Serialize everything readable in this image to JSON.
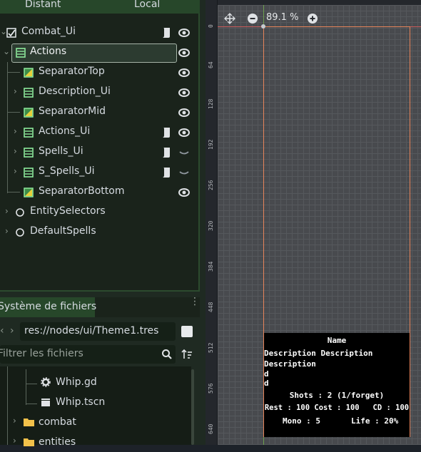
{
  "tabs": {
    "distant": "Distant",
    "local": "Local"
  },
  "tree": [
    {
      "label": "Combat_Ui",
      "icon": "control-icon",
      "script": true,
      "visible": "eye"
    },
    {
      "label": "Actions",
      "icon": "vbox-icon",
      "script": false,
      "visible": "eye",
      "selected": true
    },
    {
      "label": "SeparatorTop",
      "icon": "texture-rect-icon",
      "script": false,
      "visible": "eye"
    },
    {
      "label": "Description_Ui",
      "icon": "vbox-icon",
      "script": false,
      "visible": "eye"
    },
    {
      "label": "SeparatorMid",
      "icon": "texture-rect-icon",
      "script": false,
      "visible": "eye"
    },
    {
      "label": "Actions_Ui",
      "icon": "vbox-icon",
      "script": true,
      "visible": "eye"
    },
    {
      "label": "Spells_Ui",
      "icon": "vbox-icon",
      "script": true,
      "visible": "hidden"
    },
    {
      "label": "S_Spells_Ui",
      "icon": "vbox-icon",
      "script": true,
      "visible": "hidden"
    },
    {
      "label": "SeparatorBottom",
      "icon": "texture-rect-icon",
      "script": false,
      "visible": "eye"
    },
    {
      "label": "EntitySelectors",
      "icon": "node-icon",
      "script": false,
      "visible": "none"
    },
    {
      "label": "DefaultSpells",
      "icon": "node-icon",
      "script": false,
      "visible": "none"
    }
  ],
  "filesystem": {
    "tab_label": "Système de fichiers",
    "path": "res://nodes/ui/Theme1.tres",
    "filter_placeholder": "Filtrer les fichiers",
    "items": [
      {
        "label": "Whip.gd",
        "type": "script"
      },
      {
        "label": "Whip.tscn",
        "type": "scene"
      },
      {
        "label": "combat",
        "type": "folder"
      },
      {
        "label": "entities",
        "type": "folder"
      }
    ]
  },
  "viewport": {
    "zoom": "89.1 %",
    "ruler_labels": [
      "0",
      "64",
      "128",
      "192",
      "256",
      "320",
      "384",
      "448",
      "512",
      "576",
      "640"
    ]
  },
  "preview": {
    "name": "Name",
    "desc1": "Description Description",
    "desc2": "Description",
    "d1": "d",
    "d2": "d",
    "shots": "Shots : 2 (1/forget)",
    "rest": "Rest : 100 Cost : 100   CD : 100",
    "mono": "Mono : 5",
    "life": "Life : 20%"
  }
}
